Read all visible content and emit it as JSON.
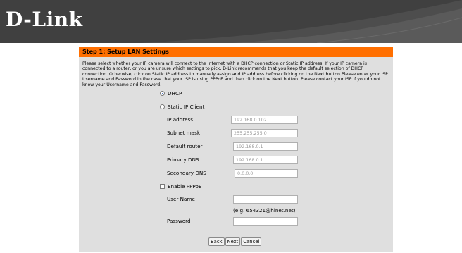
{
  "header": {
    "logo_text": "D-Link"
  },
  "wizard": {
    "title": "Step 1: Setup LAN Settings",
    "description": "Please select whether your IP camera will connect to the Internet with a DHCP connection or Static IP address. If your IP camera is connected to a router, or you are unsure which settings to pick, D-Link recommends that you keep the default selection of DHCP connection. Otherwise, click on Static IP address to manually assign and IP address before clicking on the Next button.Please enter your ISP Username and Password in the case that your ISP is using PPPoE and then click on the Next button. Please contact your ISP if you do not know your Username and Password.",
    "options": {
      "dhcp_label": "DHCP",
      "dhcp_selected": true,
      "static_label": "Static IP Client",
      "static_selected": false
    },
    "fields": {
      "ip_address": {
        "label": "IP address",
        "value": "192.168.0.102"
      },
      "subnet_mask": {
        "label": "Subnet mask",
        "value": "255.255.255.0"
      },
      "default_router": {
        "label": "Default router",
        "value": "192.168.0.1"
      },
      "primary_dns": {
        "label": "Primary DNS",
        "value": "192.168.0.1"
      },
      "secondary_dns": {
        "label": "Secondary DNS",
        "value": "0.0.0.0"
      }
    },
    "pppoe": {
      "enable_label": "Enable PPPoE",
      "enabled": false,
      "username_label": "User Name",
      "username_value": "",
      "username_hint": "(e.g. 654321@hinet.net)",
      "password_label": "Password",
      "password_value": ""
    },
    "buttons": {
      "back": "Back",
      "next": "Next",
      "cancel": "Cancel"
    }
  },
  "colors": {
    "header_bg": "#404040",
    "title_bar": "#ff6f00",
    "panel_bg": "#dfdfdf"
  }
}
